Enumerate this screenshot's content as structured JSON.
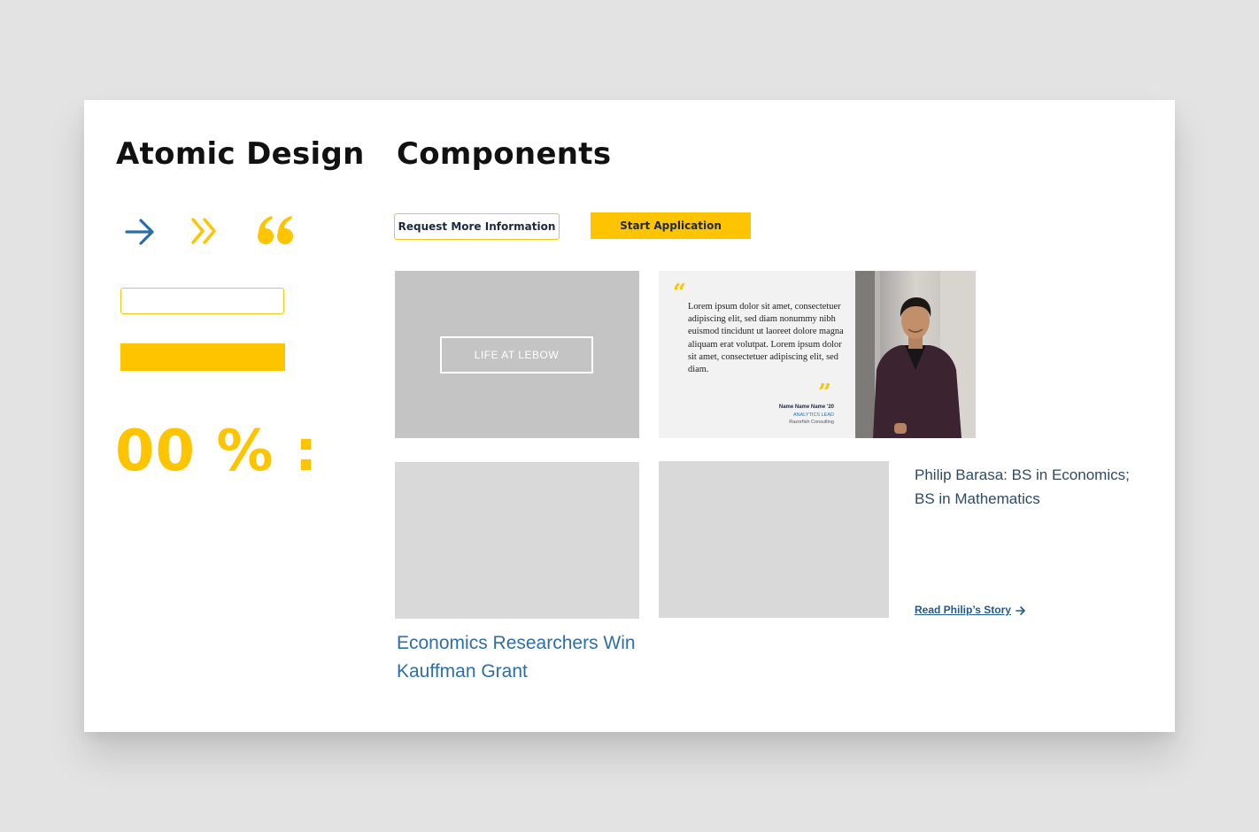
{
  "atomic": {
    "title": "Atomic Design",
    "numerals": "00 % :",
    "colors": {
      "accent_yellow": "#ffc400",
      "accent_blue": "#2a6fa8",
      "input_border": "#f5c518"
    },
    "icons": [
      "arrow-right-icon",
      "double-chevron-right-icon",
      "open-quote-icon"
    ]
  },
  "components": {
    "title": "Components",
    "buttons": {
      "request_label": "Request More Information",
      "start_label": "Start Application"
    },
    "life_tile": {
      "label": "LIFE AT LEBOW"
    },
    "quote": {
      "open_mark": "“",
      "close_mark": "”",
      "text": "Lorem ipsum dolor sit amet, consectetuer adipiscing elit, sed diam nonummy nibh euismod tincidunt ut laoreet dolore magna aliquam erat volutpat. Lorem ipsum dolor sit amet, consectetuer adipiscing elit, sed diam.",
      "name": "Name Name Name '20",
      "role": "ANALYTICS LEAD",
      "company": "Razorfish Consulting"
    },
    "news": {
      "title": "Economics Researchers Win Kauffman Grant"
    },
    "story": {
      "title": "Philip Barasa: BS in Economics; BS in Mathematics",
      "link_label": "Read Philip’s Story"
    }
  }
}
